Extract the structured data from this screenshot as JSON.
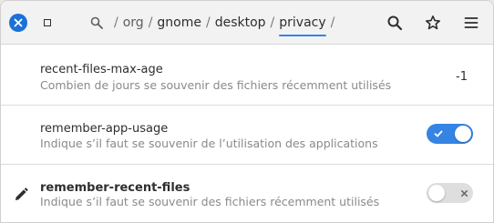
{
  "header": {
    "path": [
      "org",
      "gnome",
      "desktop",
      "privacy"
    ],
    "path_separator": "/",
    "active_segment": "privacy"
  },
  "rows": [
    {
      "key": "recent-files-max-age",
      "description": "Combien de jours se souvenir des fichiers récemment utilisés",
      "value": "-1",
      "modified": false
    },
    {
      "key": "remember-app-usage",
      "description": "Indique s’il faut se souvenir de l’utilisation des applications",
      "toggle": true,
      "modified": false
    },
    {
      "key": "remember-recent-files",
      "description": "Indique s’il faut se souvenir des fichiers récemment utilisés",
      "toggle": false,
      "modified": true
    }
  ],
  "colors": {
    "accent": "#3584e4",
    "close_button": "#1c71d8",
    "switch_off": "#dedede",
    "description_text": "#8a8a8a"
  },
  "icons": {
    "close": "close-icon",
    "maximize": "maximize-icon",
    "path_home": "search-location-icon",
    "search": "search-icon",
    "bookmark": "star-icon",
    "menu": "hamburger-menu-icon",
    "toggle_on": "check-icon",
    "toggle_off": "x-icon",
    "modified": "pencil-icon"
  }
}
